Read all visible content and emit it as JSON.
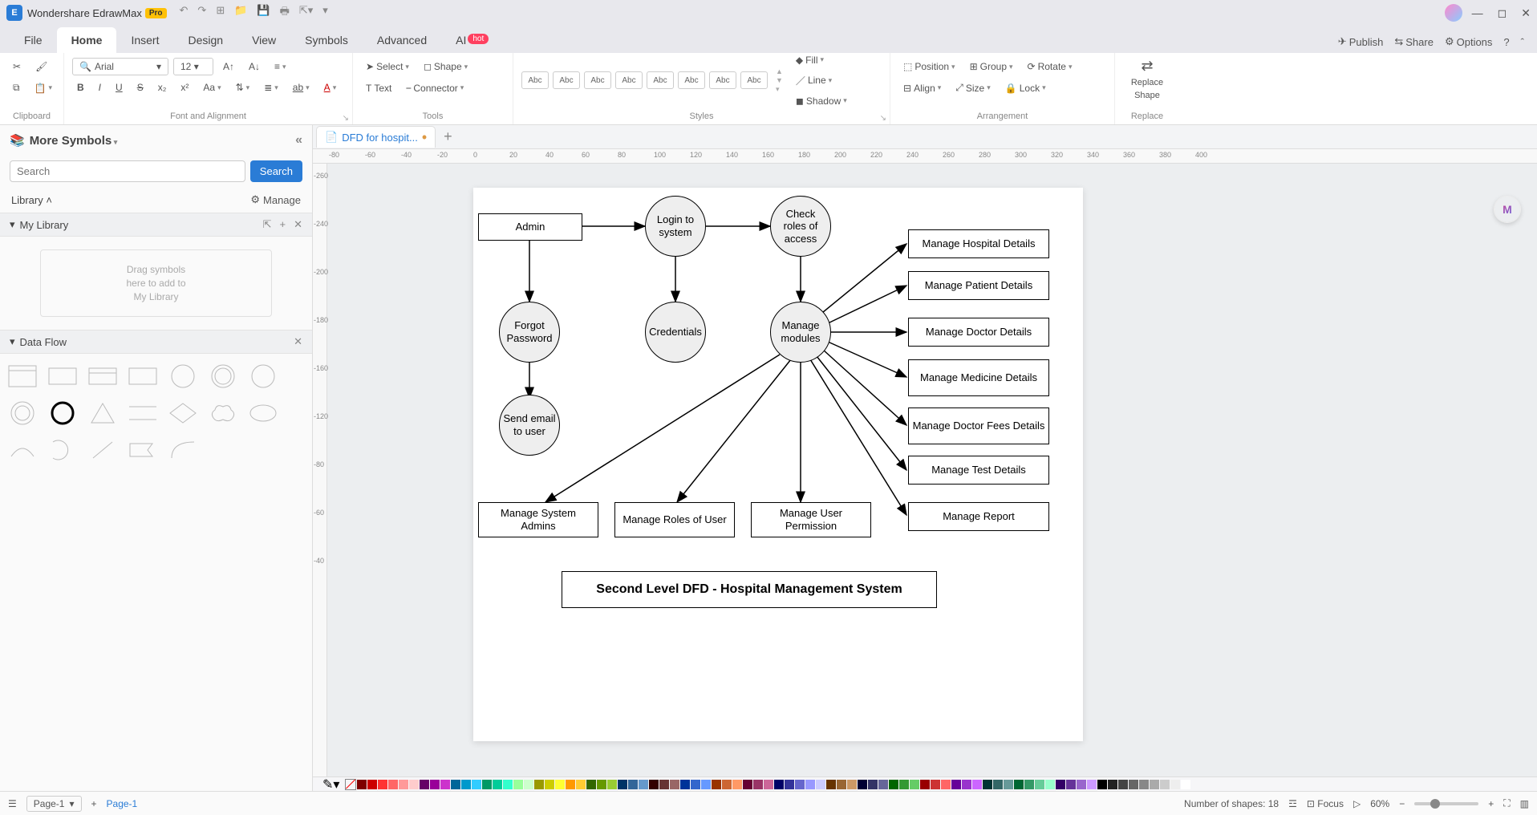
{
  "titlebar": {
    "app": "Wondershare EdrawMax",
    "pro": "Pro"
  },
  "menu": {
    "tabs": [
      "File",
      "Home",
      "Insert",
      "Design",
      "View",
      "Symbols",
      "Advanced",
      "AI"
    ],
    "active": "Home",
    "ai_badge": "hot",
    "right": {
      "publish": "Publish",
      "share": "Share",
      "options": "Options"
    }
  },
  "ribbon": {
    "clipboard": {
      "label": "Clipboard"
    },
    "font": {
      "family": "Arial",
      "size": "12",
      "label": "Font and Alignment"
    },
    "tools": {
      "select": "Select",
      "text": "Text",
      "shape": "Shape",
      "connector": "Connector",
      "label": "Tools"
    },
    "styles": {
      "sample": "Abc",
      "fill": "Fill",
      "line": "Line",
      "shadow": "Shadow",
      "label": "Styles"
    },
    "arrange": {
      "position": "Position",
      "group": "Group",
      "rotate": "Rotate",
      "align": "Align",
      "size": "Size",
      "lock": "Lock",
      "label": "Arrangement"
    },
    "replace": {
      "btn1": "Replace",
      "btn2": "Shape",
      "label": "Replace"
    }
  },
  "left": {
    "title": "More Symbols",
    "search_btn": "Search",
    "search_ph": "Search",
    "library": "Library",
    "manage": "Manage",
    "mylib": "My Library",
    "drop1": "Drag symbols",
    "drop2": "here to add to",
    "drop3": "My Library",
    "dataflow": "Data Flow"
  },
  "doc": {
    "tab": "DFD for hospit..."
  },
  "ruler_h": [
    "-80",
    "-60",
    "-40",
    "-20",
    "0",
    "20",
    "40",
    "60",
    "80",
    "100",
    "120",
    "140",
    "160",
    "180",
    "200",
    "220",
    "240",
    "260",
    "280",
    "300",
    "320",
    "340",
    "360",
    "380",
    "400"
  ],
  "ruler_v": [
    "-260",
    "-240",
    "-200",
    "-180",
    "-160",
    "-120",
    "-80",
    "-60",
    "-40"
  ],
  "dfd": {
    "admin": "Admin",
    "login": "Login to system",
    "check": "Check roles of access",
    "forgot": "Forgot Password",
    "creds": "Credentials",
    "modules": "Manage modules",
    "send": "Send email to user",
    "mhd": "Manage Hospital Details",
    "mpd": "Manage Patient Details",
    "mdd": "Manage Doctor Details",
    "mmd": "Manage Medicine Details",
    "mdfd": "Manage Doctor Fees Details",
    "mtd": "Manage Test Details",
    "mr": "Manage Report",
    "msa": "Manage System Admins",
    "mru": "Manage Roles of User",
    "mup": "Manage User Permission",
    "title": "Second Level DFD - Hospital Management System"
  },
  "status": {
    "page_sel": "Page-1",
    "page_link": "Page-1",
    "shapes": "Number of shapes: 18",
    "focus": "Focus",
    "zoom": "60%"
  },
  "colors": [
    "#7f0000",
    "#c00",
    "#f33",
    "#f66",
    "#f99",
    "#fcc",
    "#606",
    "#909",
    "#c3c",
    "#069",
    "#09c",
    "#3cf",
    "#096",
    "#0c9",
    "#3fc",
    "#9f9",
    "#cfc",
    "#990",
    "#cc0",
    "#ff3",
    "#f90",
    "#fc3",
    "#360",
    "#690",
    "#9c3",
    "#036",
    "#369",
    "#69c",
    "#300",
    "#633",
    "#966",
    "#039",
    "#36c",
    "#69f",
    "#930",
    "#c63",
    "#f96",
    "#603",
    "#936",
    "#c69",
    "#006",
    "#339",
    "#66c",
    "#99f",
    "#ccf",
    "#630",
    "#963",
    "#c96",
    "#003",
    "#336",
    "#669",
    "#060",
    "#393",
    "#6c6",
    "#900",
    "#c33",
    "#f66",
    "#609",
    "#93c",
    "#c6f",
    "#033",
    "#366",
    "#699",
    "#063",
    "#396",
    "#6c9",
    "#9fc",
    "#306",
    "#639",
    "#96c",
    "#c9f",
    "#000",
    "#222",
    "#444",
    "#666",
    "#888",
    "#aaa",
    "#ccc",
    "#eee",
    "#fff"
  ]
}
